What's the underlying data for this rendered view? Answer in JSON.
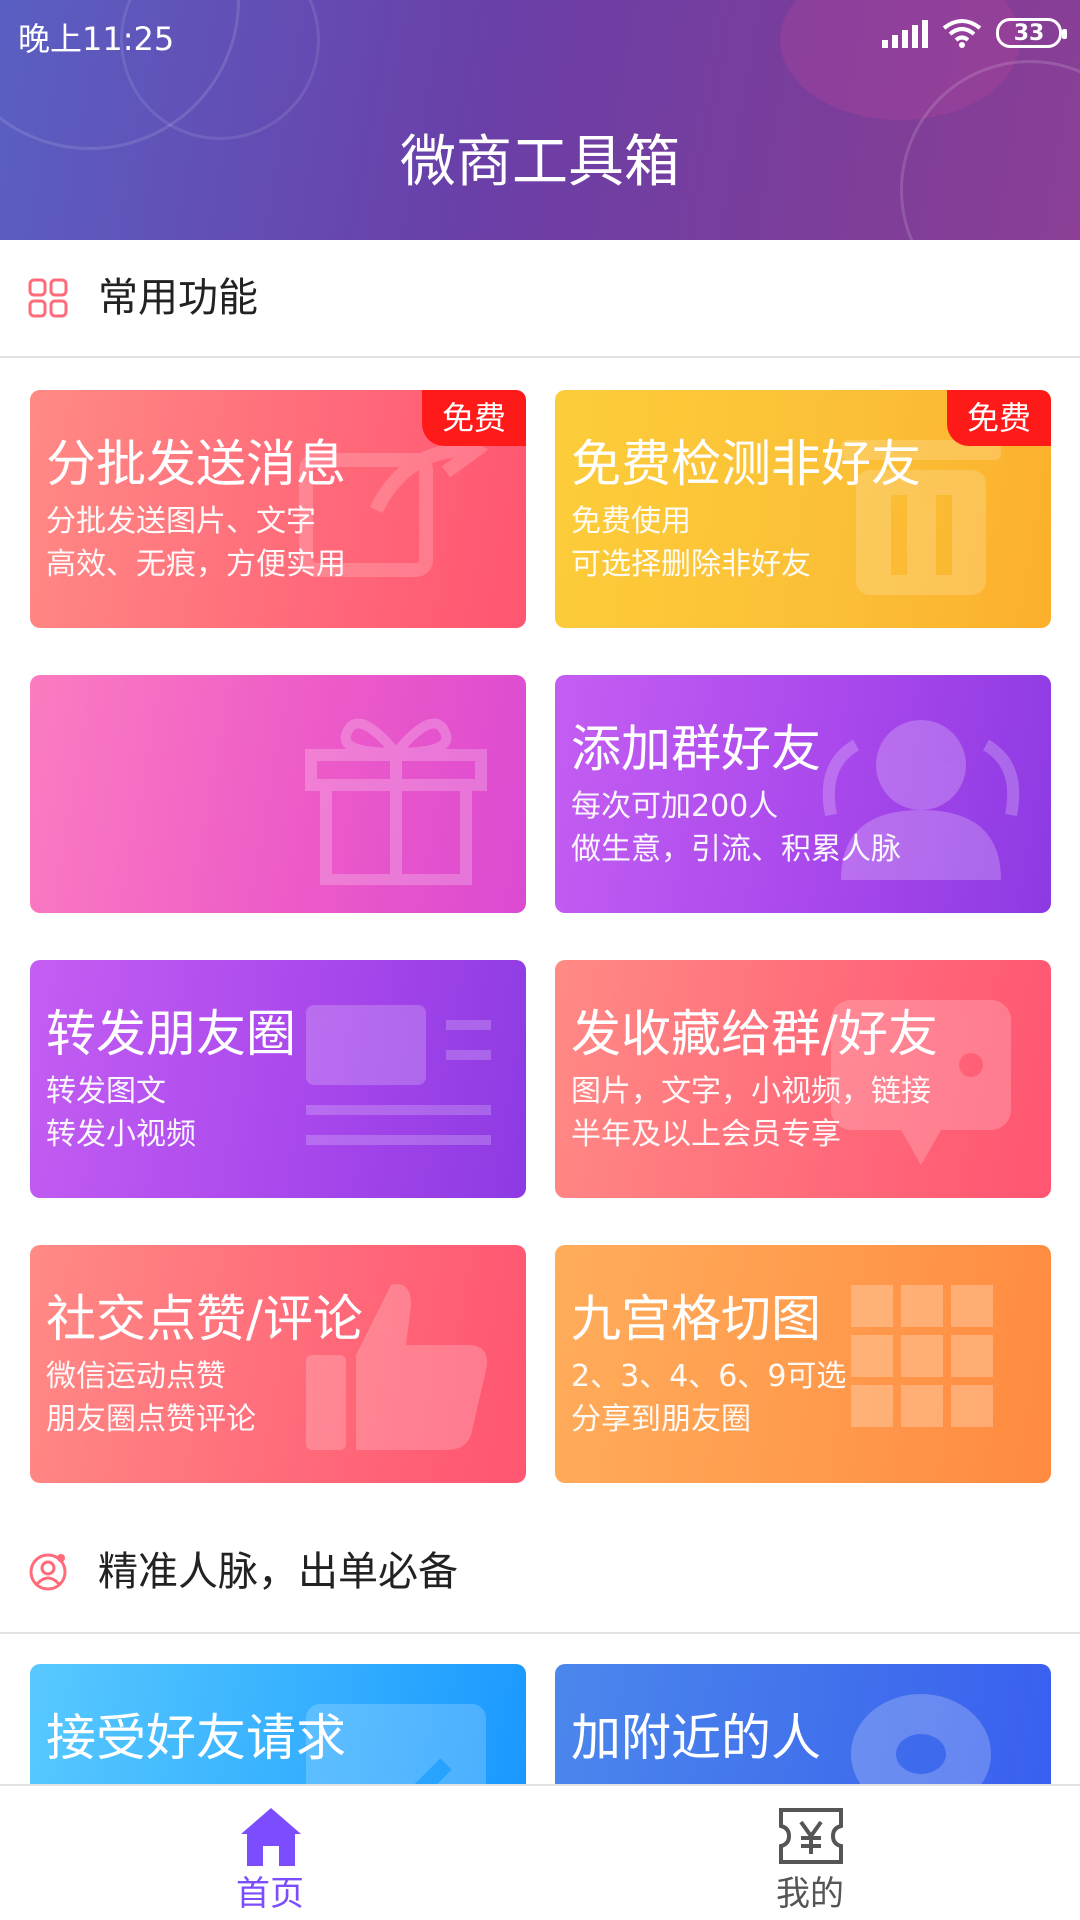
{
  "status_bar": {
    "time": "晚上11:25",
    "battery": "33"
  },
  "app": {
    "title": "微商工具箱"
  },
  "sections": [
    {
      "title": "常用功能",
      "icon": "grid-icon"
    },
    {
      "title": "精准人脉，出单必备",
      "icon": "user-circle-icon"
    }
  ],
  "cards": [
    {
      "title": "分批发送消息",
      "line1": "分批发送图片、文字",
      "line2": "高效、无痕，方便实用",
      "badge": "免费",
      "icon": "share-forward-icon",
      "color": "#ff6b7a"
    },
    {
      "title": "免费检测非好友",
      "line1": "免费使用",
      "line2": "可选择删除非好友",
      "badge": "免费",
      "icon": "trash-icon",
      "color": "#fbbf36"
    },
    {
      "title": "",
      "line1": "",
      "line2": "",
      "icon": "gift-icon",
      "color": "#ed5bc8"
    },
    {
      "title": "添加群好友",
      "line1": "每次可加200人",
      "line2": "做生意，引流、积累人脉",
      "icon": "group-icon",
      "color": "#a948ec"
    },
    {
      "title": "转发朋友圈",
      "line1": "转发图文",
      "line2": "转发小视频",
      "icon": "article-icon",
      "color": "#a948ec"
    },
    {
      "title": "发收藏给群/好友",
      "line1": "图片，文字，小视频，链接",
      "line2": "半年及以上会员专享",
      "icon": "chat-bubble-icon",
      "color": "#ff6b7a"
    },
    {
      "title": "社交点赞/评论",
      "line1": "微信运动点赞",
      "line2": "朋友圈点赞评论",
      "icon": "thumbs-up-icon",
      "color": "#ff6b7a"
    },
    {
      "title": "九宫格切图",
      "line1": "2、3、4、6、9可选",
      "line2": "分享到朋友圈",
      "icon": "nine-grid-icon",
      "color": "#ff9a4c"
    },
    {
      "title": "接受好友请求",
      "icon": "check-card-icon",
      "color": "#36b0ff"
    },
    {
      "title": "加附近的人",
      "icon": "location-pin-icon",
      "color": "#4171ec"
    }
  ],
  "bottom_nav": [
    {
      "label": "首页",
      "icon": "home-icon",
      "active": true,
      "color": "#7b4dff"
    },
    {
      "label": "我的",
      "icon": "ticket-yen-icon",
      "active": false,
      "color": "#555555"
    }
  ]
}
